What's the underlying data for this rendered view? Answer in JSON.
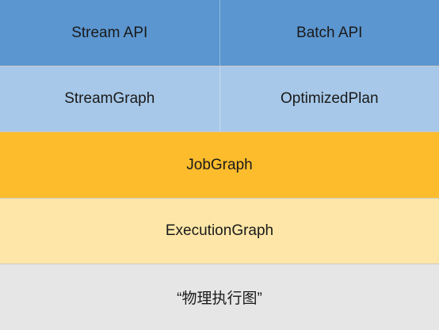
{
  "layers": {
    "api": {
      "left": "Stream API",
      "right": "Batch API",
      "color": "#5b96d0"
    },
    "graph": {
      "left": "StreamGraph",
      "right": "OptimizedPlan",
      "color": "#a7c8e8"
    },
    "job": {
      "label": "JobGraph",
      "color": "#fcbc2c"
    },
    "execution": {
      "label": "ExecutionGraph",
      "color": "#fde6a7"
    },
    "physical": {
      "label": "“物理执行图”",
      "color": "#e6e6e6"
    }
  }
}
